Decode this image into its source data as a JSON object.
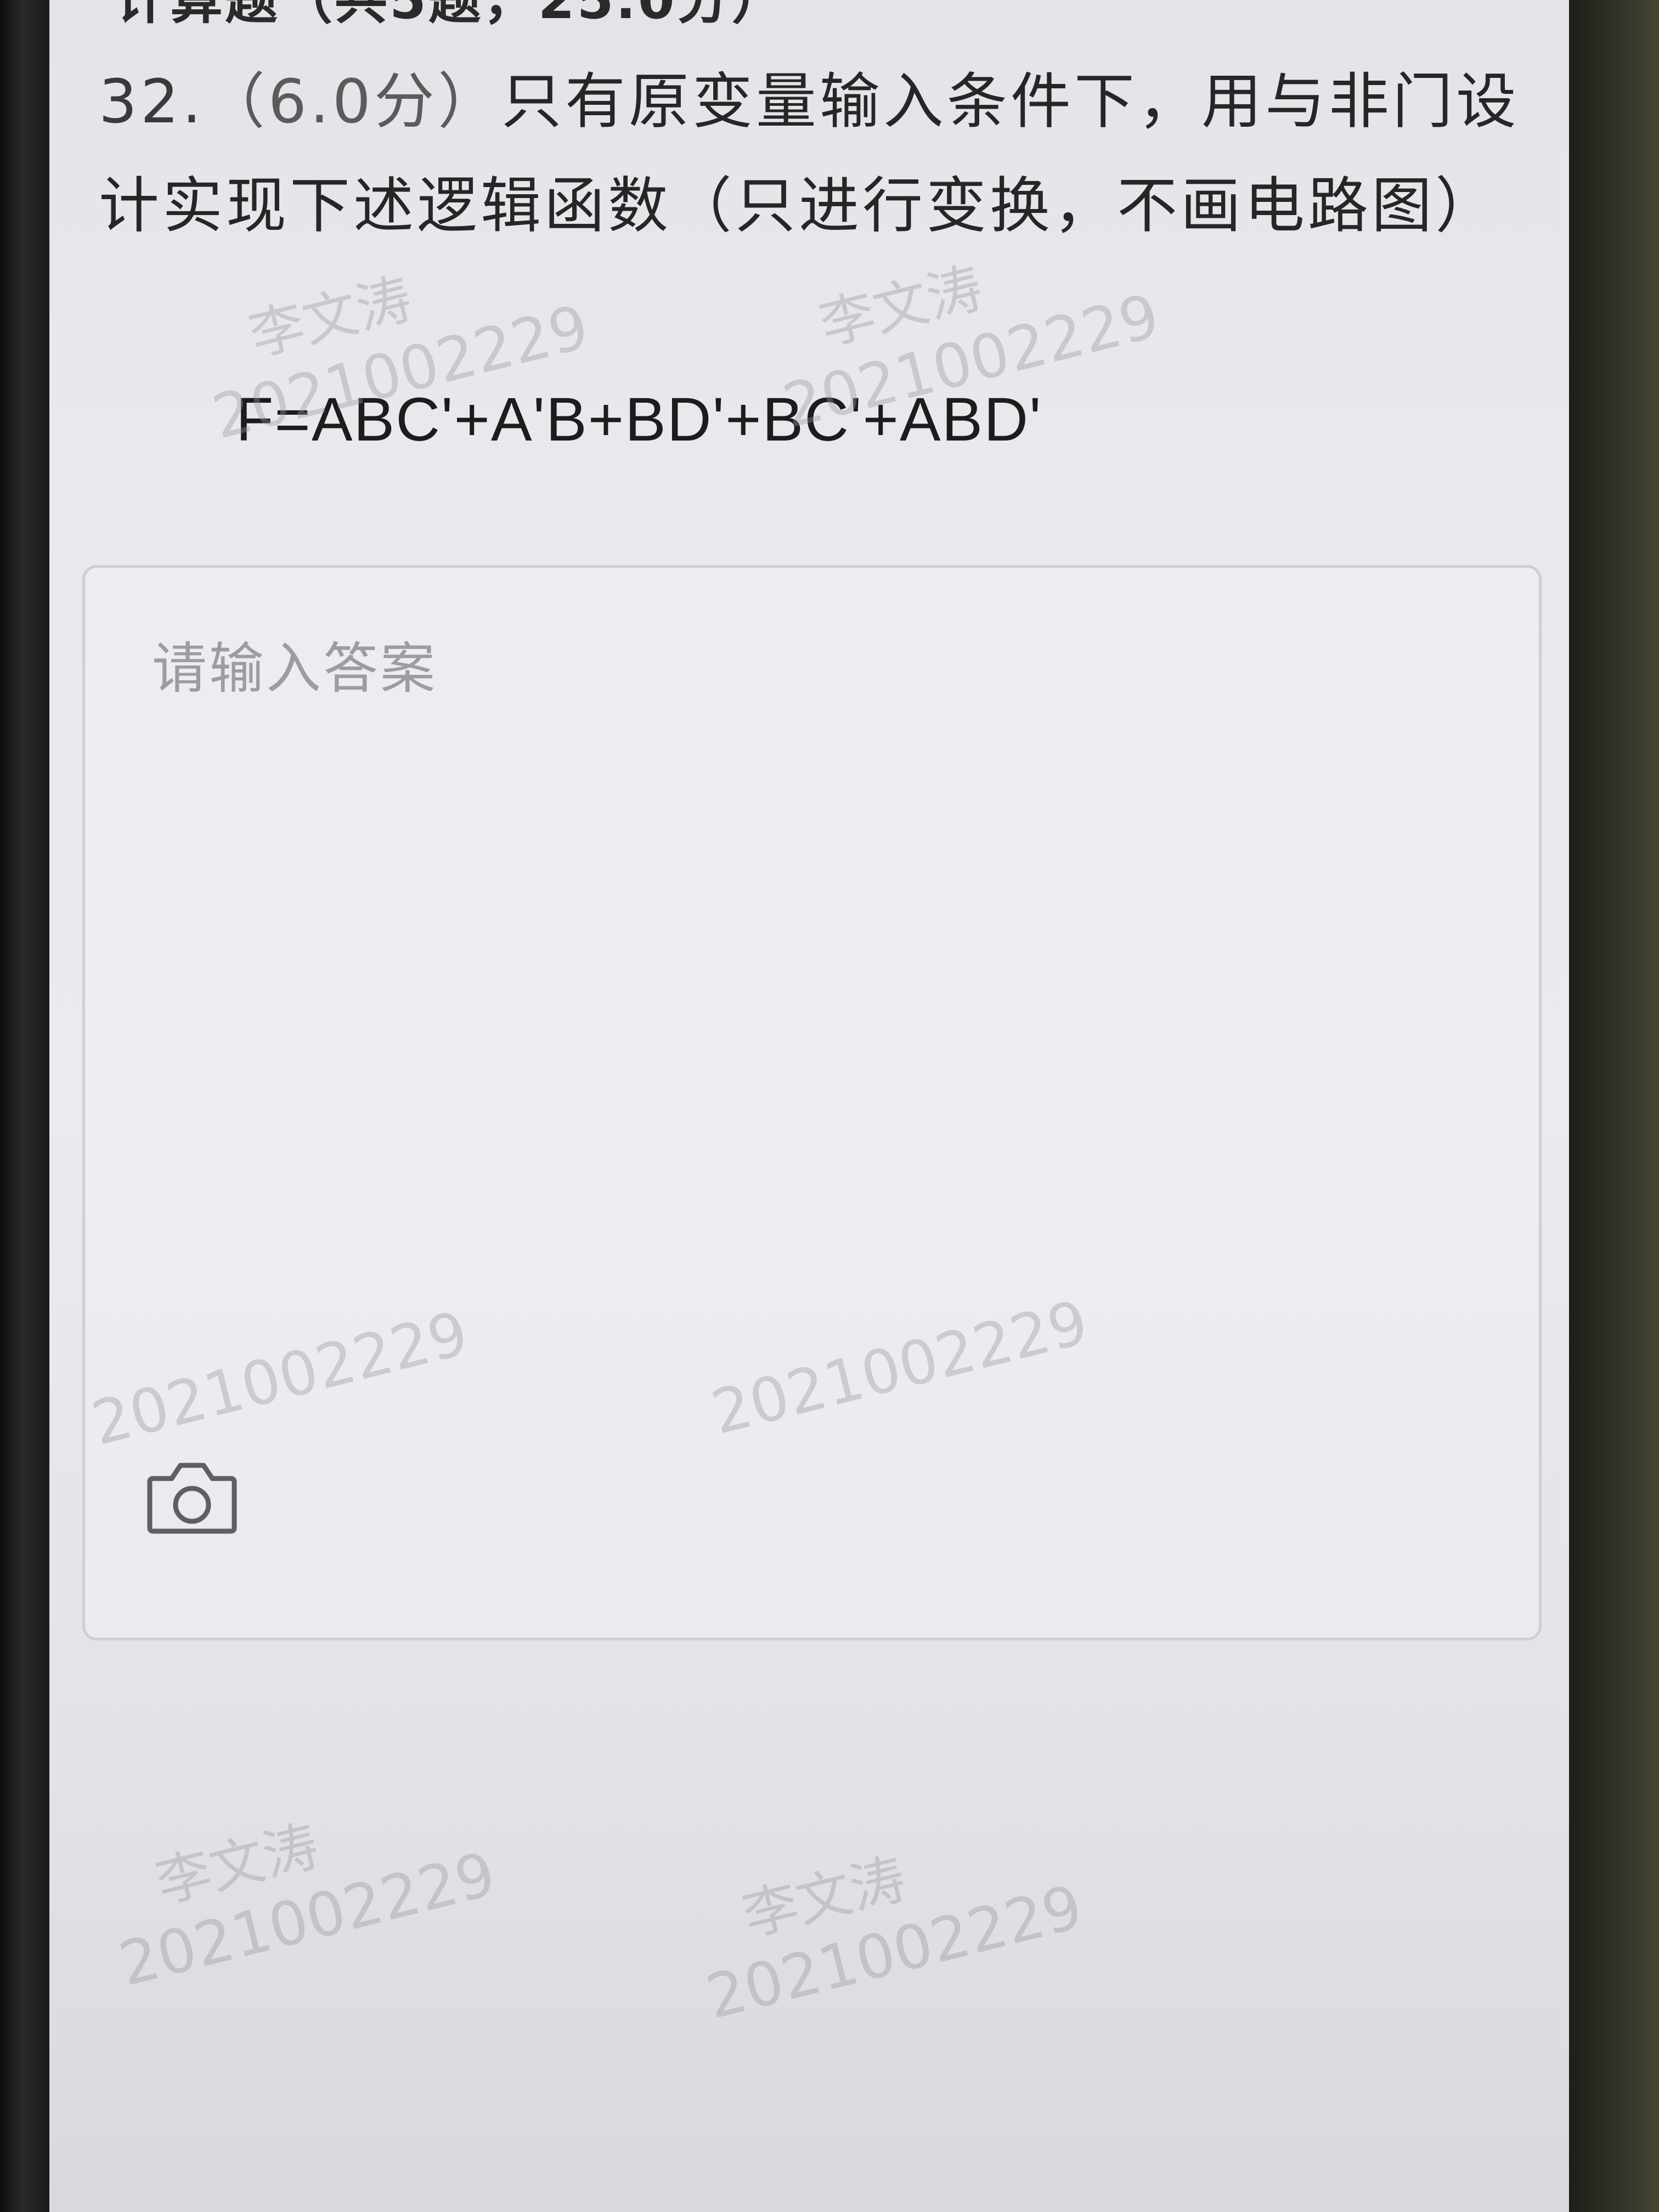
{
  "question": {
    "number": "32.",
    "score": "（6.0分）",
    "text": "只有原变量输入条件下，用与非门设计实现下述逻辑函数（只进行变换，不画电路图）",
    "formula": "F=ABC'+A'B+BD'+BC'+ABD'"
  },
  "answer": {
    "placeholder": "请输入答案",
    "value": ""
  },
  "upload": {
    "icon": "camera-icon"
  },
  "watermark": {
    "name": "李文涛",
    "id": "2021002229"
  },
  "colors": {
    "background": "#e9e8ed",
    "text": "#262626",
    "placeholder": "#9d9ca3",
    "box_border": "#cfced4",
    "watermark": "#9696a0"
  }
}
